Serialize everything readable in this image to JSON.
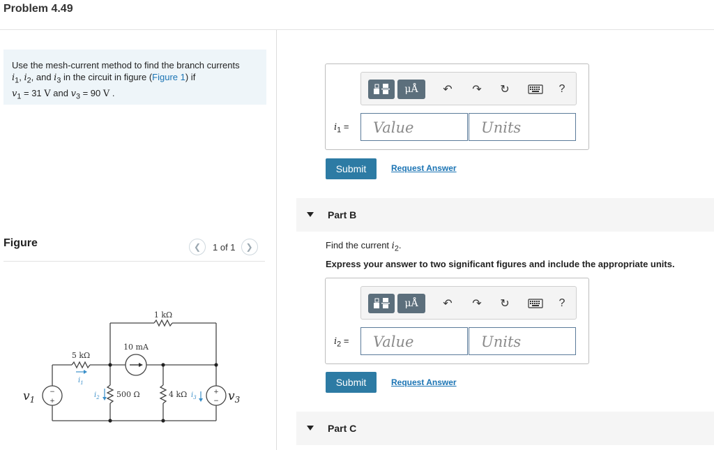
{
  "problem": {
    "title": "Problem 4.49"
  },
  "prompt": {
    "part1": "Use the mesh-current method to find the branch currents",
    "var_i1": "i",
    "sub_1": "1",
    "comma1": ", ",
    "var_i2": "i",
    "sub_2": "2",
    "and1": ", and ",
    "var_i3": "i",
    "sub_3": "3",
    "part2": " in the circuit in figure (",
    "link": "Figure 1",
    "part3": ") if",
    "var_v1": "v",
    "sub_v1": "1",
    "eq1": " = 31 ",
    "unit_v": "V",
    "and2": " and ",
    "var_v3": "v",
    "sub_v3": "3",
    "eq2": " = 90 ",
    "unit_v2": "V",
    "period": " ."
  },
  "figure": {
    "label": "Figure",
    "counter": "1 of 1",
    "prev_icon": "chevron-left-icon",
    "next_icon": "chevron-right-icon",
    "circuit": {
      "r_top": "1 kΩ",
      "r_left": "5 kΩ",
      "cs": "10 mA",
      "r_mid": "500 Ω",
      "r_right": "4 kΩ",
      "v1_label": "v",
      "v1_sub": "1",
      "v3_label": "v",
      "v3_sub": "3",
      "i1_label": "i",
      "i1_sub": "1",
      "i2_label": "i",
      "i2_sub": "2",
      "i3_label": "i",
      "i3_sub": "3",
      "plus": "+",
      "minus": "−"
    }
  },
  "toolbar": {
    "templates_icon": "templates-icon",
    "units_label": "μÅ",
    "undo_icon": "undo-icon",
    "redo_icon": "redo-icon",
    "reset_icon": "reset-icon",
    "keyboard_icon": "keyboard-icon",
    "help_label": "?"
  },
  "partA": {
    "var": "i",
    "sub": "1",
    "eq": " =",
    "value_placeholder": "Value",
    "units_placeholder": "Units",
    "submit": "Submit",
    "request": "Request Answer"
  },
  "partB": {
    "title": "Part B",
    "question_pre": "Find the current ",
    "question_var": "i",
    "question_sub": "2",
    "question_post": ".",
    "instruction": "Express your answer to two significant figures and include the appropriate units.",
    "var": "i",
    "sub": "2",
    "eq": " =",
    "value_placeholder": "Value",
    "units_placeholder": "Units",
    "submit": "Submit",
    "request": "Request Answer"
  },
  "partC": {
    "title": "Part C"
  },
  "colors": {
    "accent": "#2d7ba4",
    "link": "#1b74b4",
    "prompt_bg": "#eef5f9",
    "part_bg": "#f5f5f5"
  }
}
